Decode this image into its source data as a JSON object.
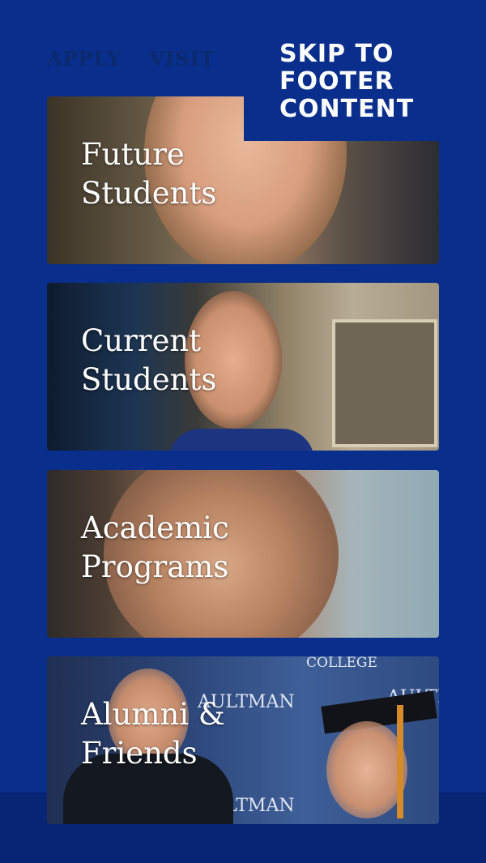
{
  "nav": {
    "apply": "APPLY",
    "visit": "VISIT"
  },
  "skip_link": {
    "label": "SKIP TO FOOTER CONTENT"
  },
  "cards": [
    {
      "label": "Future Students"
    },
    {
      "label": "Current Students"
    },
    {
      "label": "Academic Programs"
    },
    {
      "label": "Alumni & Friends"
    }
  ],
  "banners": {
    "college": "COLLEGE",
    "aultman": "AULTMAN"
  },
  "colors": {
    "background": "#0a2e8c",
    "bottom_band": "#082474",
    "nav_text": "#0b2a6e",
    "text": "#ffffff"
  }
}
